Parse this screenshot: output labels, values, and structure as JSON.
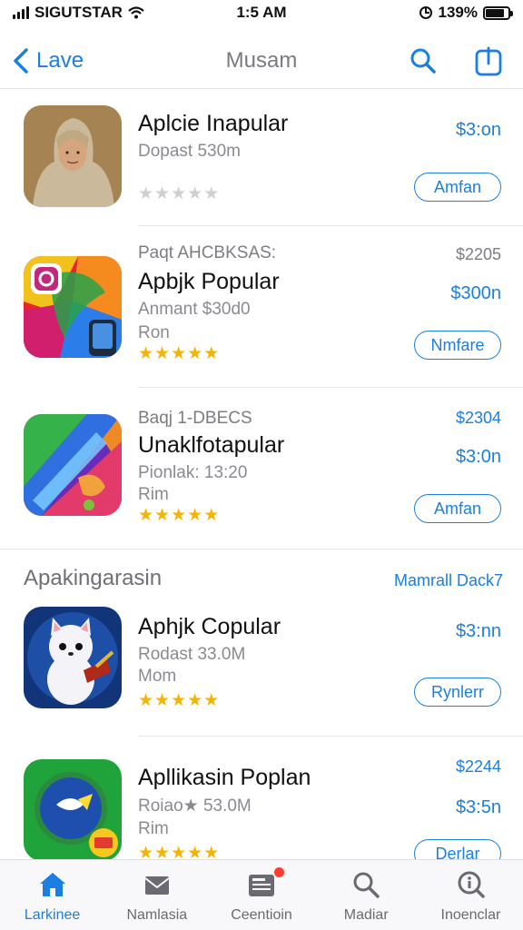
{
  "status_bar": {
    "carrier": "SIGUTSTAR",
    "time": "1:5 AM",
    "battery_text": "139%",
    "battery_level": 0.85
  },
  "nav": {
    "back_label": "Lave",
    "title": "Musam",
    "back_icon": "chevron-left-icon",
    "search_icon": "search-icon",
    "share_icon": "share-icon"
  },
  "apps": [
    {
      "pre": "",
      "name": "Aplcie Inapular",
      "subtitle": "Dopast 530m",
      "subtitle2": "",
      "rating": 0,
      "price_top": "",
      "price": "$3:on",
      "button": "Amfan",
      "icon": "portrait-icon"
    },
    {
      "pre": "Paqt AHCBKSAS:",
      "name": "Apbjk Popular",
      "subtitle": "Anmant $30d0",
      "subtitle2": "Ron",
      "rating": 5,
      "price_top": "$2205",
      "price": "$300n",
      "button": "Nmfare",
      "icon": "camera-app-icon"
    },
    {
      "pre": "Baqj 1-DBECS",
      "name": "Unaklfotapular",
      "subtitle": "Pionlak: 13:20",
      "subtitle2": "Rim",
      "rating": 5,
      "price_top": "$2304",
      "price": "$3:0n",
      "button": "Amfan",
      "icon": "paint-app-icon"
    },
    {
      "pre": "",
      "name": "Aphjk Copular",
      "subtitle": "Rodast 33.0M",
      "subtitle2": "Mom",
      "rating": 5,
      "price_top": "",
      "price": "$3:nn",
      "button": "Rynlerr",
      "icon": "cat-game-icon"
    },
    {
      "pre": "",
      "name": "Apllikasin Poplan",
      "subtitle": "Roiao★ 53.0M",
      "subtitle2": "Rim",
      "rating": 5,
      "price_top": "$2244",
      "price": "$3:5n",
      "button": "Derlar",
      "icon": "chat-app-icon"
    }
  ],
  "section": {
    "title": "Apakingarasin",
    "link": "Mamrall Dack7"
  },
  "tabs": [
    {
      "label": "Larkinee",
      "icon": "home-icon",
      "active": true
    },
    {
      "label": "Namlasia",
      "icon": "mail-icon",
      "active": false
    },
    {
      "label": "Ceentioin",
      "icon": "news-icon",
      "active": false,
      "badge": true
    },
    {
      "label": "Madiar",
      "icon": "search-icon",
      "active": false
    },
    {
      "label": "Inoenclar",
      "icon": "info-icon",
      "active": false
    }
  ],
  "colors": {
    "accent": "#1a7fe0",
    "star": "#f5b400",
    "badge": "#ff3b30"
  }
}
